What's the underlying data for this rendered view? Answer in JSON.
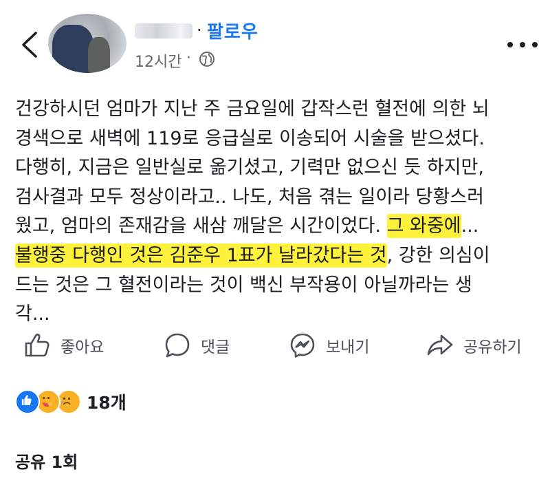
{
  "header": {
    "follow_label": "팔로우",
    "separator": "·",
    "time": "12시간",
    "time_separator": "·",
    "audience_icon": "globe-icon",
    "more_icon": "more-options-icon",
    "back_icon": "back-chevron-icon"
  },
  "post": {
    "lines": [
      {
        "pre": "건강하시던 엄마가 지난 주 금요일에 갑작스런 혈전에 의한 뇌",
        "hl": "",
        "post": ""
      },
      {
        "pre": "경색으로 새벽에 119로 응급실로 이송되어  시술을 받으셨다.",
        "hl": "",
        "post": ""
      },
      {
        "pre": "다행히, 지금은 일반실로 옮기셨고, 기력만 없으신 듯 하지만,",
        "hl": "",
        "post": ""
      },
      {
        "pre": "검사결과 모두 정상이라고..  나도, 처음 겪는 일이라 당황스러",
        "hl": "",
        "post": ""
      },
      {
        "pre": "웠고, 엄마의 존재감을 새삼 깨달은 시간이었다. ",
        "hl": "그 와중에",
        "post": "..."
      },
      {
        "pre": "",
        "hl": "불행중 다행인 것은 김준우 1표가 날라갔다는 것",
        "post": ", 강한 의심이"
      },
      {
        "pre": "드는 것은 그 혈전이라는 것이 백신 부작용이 아닐까라는 생",
        "hl": "",
        "post": ""
      },
      {
        "pre": "각...",
        "hl": "",
        "post": ""
      }
    ],
    "highlight_color": "#fff23d"
  },
  "actions": {
    "like_label": "좋아요",
    "comment_label": "댓글",
    "send_label": "보내기",
    "share_label": "공유하기"
  },
  "reactions": {
    "types": [
      "like-reaction-icon",
      "care-reaction-icon",
      "sad-reaction-icon"
    ],
    "count": "18개"
  },
  "shares": {
    "label": "공유 1회"
  },
  "colors": {
    "accent": "#1877f2",
    "text": "#1c1e21",
    "secondary_text": "#65676b"
  }
}
